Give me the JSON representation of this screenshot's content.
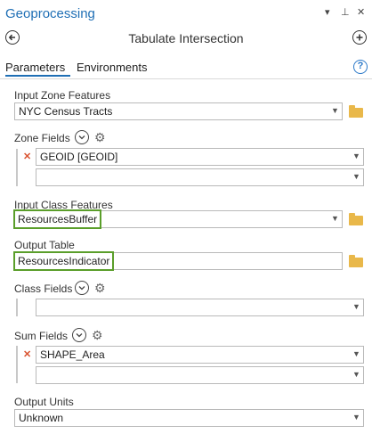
{
  "pane": {
    "title": "Geoprocessing",
    "minimize_icon": "▾",
    "pin_icon": "⊥",
    "close_icon": "✕"
  },
  "tool": {
    "title": "Tabulate Intersection"
  },
  "tabs": [
    {
      "label": "Parameters",
      "active": true
    },
    {
      "label": "Environments",
      "active": false
    }
  ],
  "help": {
    "symbol": "?"
  },
  "params": {
    "input_zone": {
      "label": "Input Zone Features",
      "value": "NYC Census Tracts"
    },
    "zone_fields": {
      "label": "Zone Fields",
      "items": [
        "GEOID [GEOID]",
        ""
      ]
    },
    "input_class": {
      "label": "Input Class Features",
      "value": "ResourcesBuffer"
    },
    "output_table": {
      "label": "Output Table",
      "value": "ResourcesIndicator"
    },
    "class_fields": {
      "label": "Class Fields",
      "items": [
        ""
      ]
    },
    "sum_fields": {
      "label": "Sum Fields",
      "items": [
        "SHAPE_Area",
        ""
      ]
    },
    "output_units": {
      "label": "Output Units",
      "value": "Unknown"
    }
  },
  "colors": {
    "accent": "#1f6fb5",
    "highlight": "#5a9e2a",
    "folder": "#e9b84a",
    "remove": "#d9522f"
  }
}
